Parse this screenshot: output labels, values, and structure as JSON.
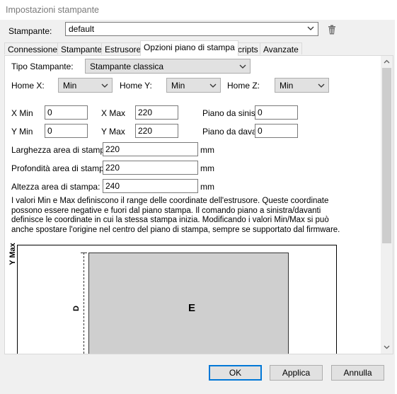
{
  "window": {
    "title": "Impostazioni stampante"
  },
  "printer": {
    "label": "Stampante:",
    "value": "default"
  },
  "tabs": [
    {
      "label": "Connessione"
    },
    {
      "label": "Stampante"
    },
    {
      "label": "Estrusore"
    },
    {
      "label": "Opzioni piano di stampa",
      "active": true
    },
    {
      "label": "Scripts"
    },
    {
      "label": "Avanzate"
    }
  ],
  "bed": {
    "printer_type_label": "Tipo Stampante:",
    "printer_type_value": "Stampante classica",
    "home_x_label": "Home X:",
    "home_x_value": "Min",
    "home_y_label": "Home Y:",
    "home_y_value": "Min",
    "home_z_label": "Home Z:",
    "home_z_value": "Min",
    "x_min_label": "X Min",
    "x_min_value": "0",
    "x_max_label": "X Max",
    "x_max_value": "220",
    "bed_left_label": "Piano da sinistra:",
    "bed_left_value": "0",
    "y_min_label": "Y Min",
    "y_min_value": "0",
    "y_max_label": "Y Max",
    "y_max_value": "220",
    "bed_front_label": "Piano da davanti:",
    "bed_front_value": "0",
    "width_label": "Larghezza area di stampa:",
    "width_value": "220",
    "depth_label": "Profondità area di stampa:",
    "depth_value": "220",
    "height_label": "Altezza area di stampa:",
    "height_value": "240",
    "unit": "mm",
    "description": "I valori Min e Max definiscono il range delle coordinate dell'estrusore. Queste coordinate possono essere negative e fuori dal piano stampa. Il comando piano a sinistra/davanti definisce le coordinate in cui la stessa stampa inizia. Modificando i valori Min/Max si può anche spostare l'origine nel centro del piano di stampa, sempre se supportato dal firmware."
  },
  "diagram": {
    "y_axis_label": "Y Max",
    "dimension_label": "D",
    "extruder_label": "E"
  },
  "buttons": {
    "ok": "OK",
    "apply": "Applica",
    "cancel": "Annulla"
  }
}
